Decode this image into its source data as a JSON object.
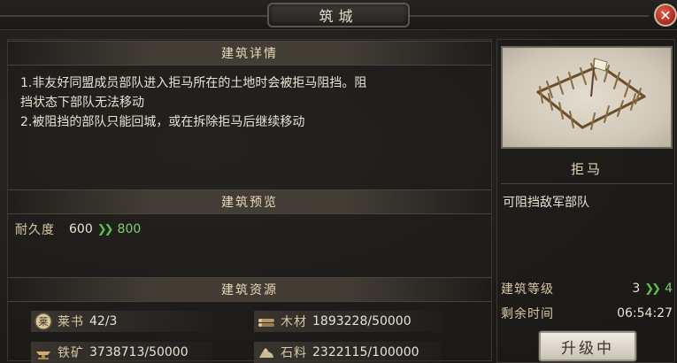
{
  "window": {
    "title": "筑城",
    "close_label": "✕"
  },
  "details": {
    "header": "建筑详情",
    "line1": "1.非友好同盟成员部队进入拒马所在的土地时会被拒马阻挡。阻",
    "line2": "挡状态下部队无法移动",
    "line3": "2.被阻挡的部队只能回城，或在拆除拒马后继续移动"
  },
  "preview": {
    "header": "建筑预览",
    "durability_label": "耐久度",
    "durability_current": "600",
    "durability_next": "800",
    "arrow": "❯❯"
  },
  "resources": {
    "header": "建筑资源",
    "items": [
      {
        "icon": "book-icon",
        "name": "莱书",
        "amount": "42/3"
      },
      {
        "icon": "wood-icon",
        "name": "木材",
        "amount": "1893228/50000"
      },
      {
        "icon": "iron-icon",
        "name": "铁矿",
        "amount": "3738713/50000"
      },
      {
        "icon": "stone-icon",
        "name": "石料",
        "amount": "2322115/100000"
      }
    ]
  },
  "building": {
    "name": "拒马",
    "description": "可阻挡敌军部队",
    "level_label": "建筑等级",
    "level_current": "3",
    "level_next": "4",
    "time_label": "剩余时间",
    "time_value": "06:54:27",
    "upgrade_label": "升级中"
  },
  "colors": {
    "upgrade_green": "#7fcf6e",
    "close_red": "#c0392b",
    "text_gold": "#d8c8a4"
  }
}
